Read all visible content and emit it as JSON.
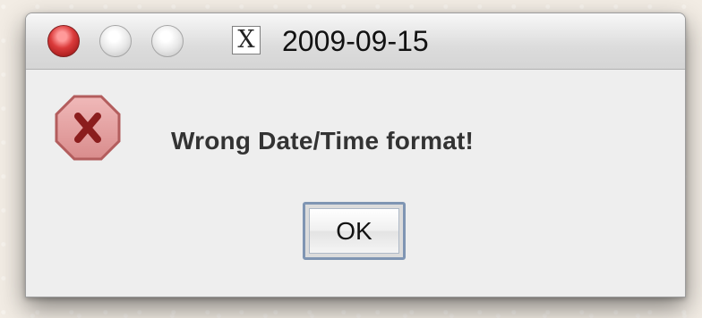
{
  "window": {
    "title": "2009-09-15",
    "proxy_icon_text": "X"
  },
  "dialog": {
    "message": "Wrong Date/Time format!",
    "ok_label": "OK",
    "icon": "error-stop-icon"
  },
  "colors": {
    "close_button": "#db3b3b",
    "error_icon_fill": "#e9a3a3",
    "error_icon_mark": "#8b1d1d"
  }
}
